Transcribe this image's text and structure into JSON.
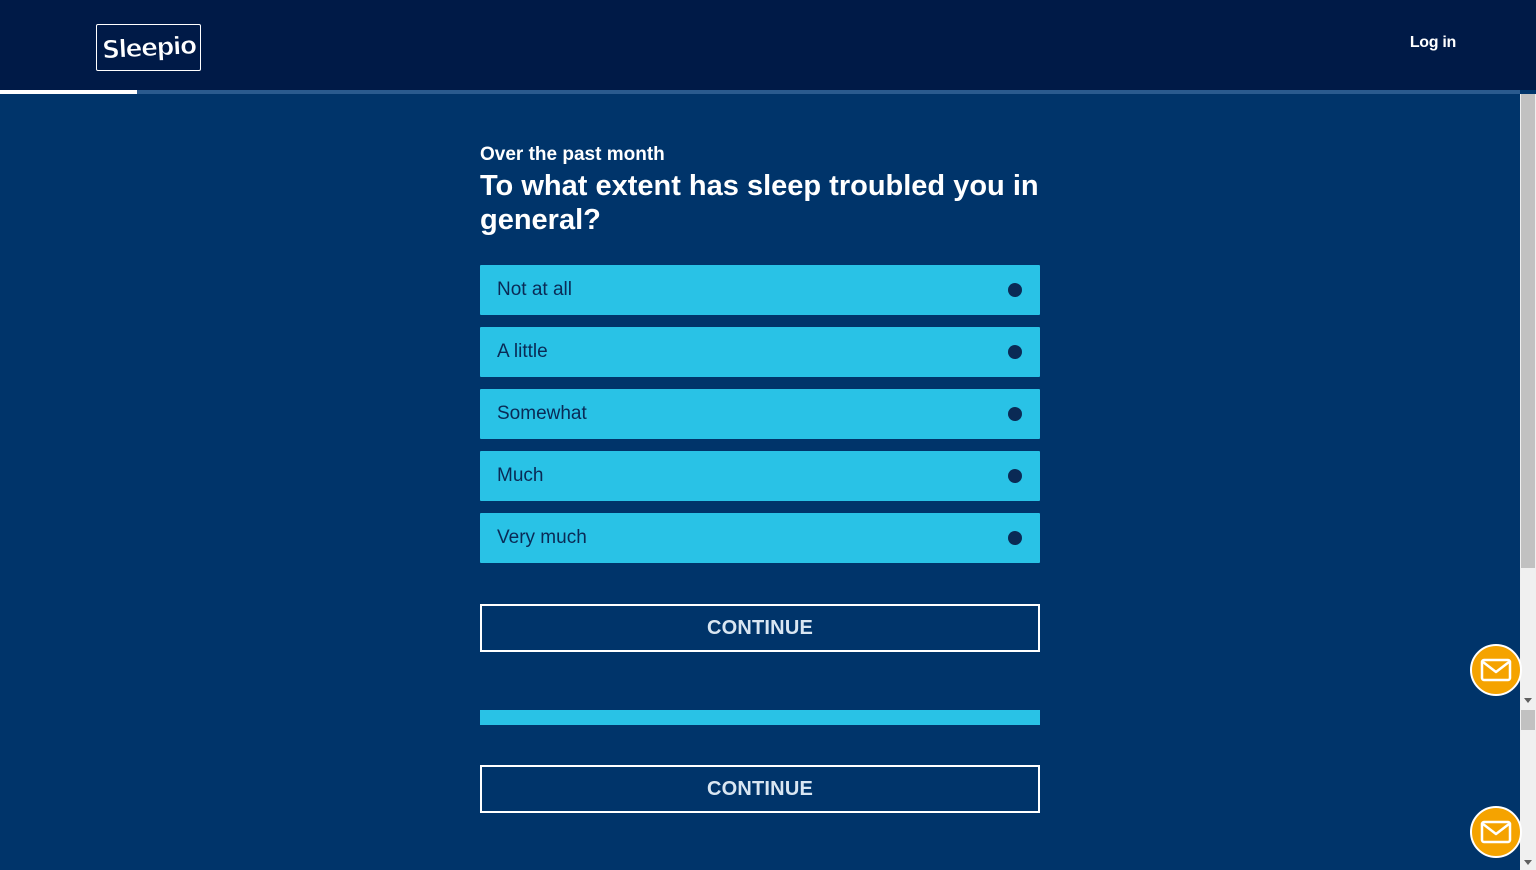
{
  "header": {
    "logo_text": "Sleepio",
    "login_label": "Log in"
  },
  "progress": {
    "fraction": 0.09
  },
  "question": {
    "eyebrow": "Over the past month",
    "text": "To what extent has sleep troubled you in general?"
  },
  "options": [
    {
      "label": "Not at all"
    },
    {
      "label": "A little"
    },
    {
      "label": "Somewhat"
    },
    {
      "label": "Much"
    },
    {
      "label": "Very much"
    }
  ],
  "buttons": {
    "continue_primary": "CONTINUE",
    "continue_secondary": "CONTINUE"
  },
  "colors": {
    "header_bg": "#001a47",
    "page_bg": "#00346a",
    "option_bg": "#29c2e6",
    "chat_bg": "#f5a300"
  },
  "icons": {
    "chat": "mail-icon"
  }
}
